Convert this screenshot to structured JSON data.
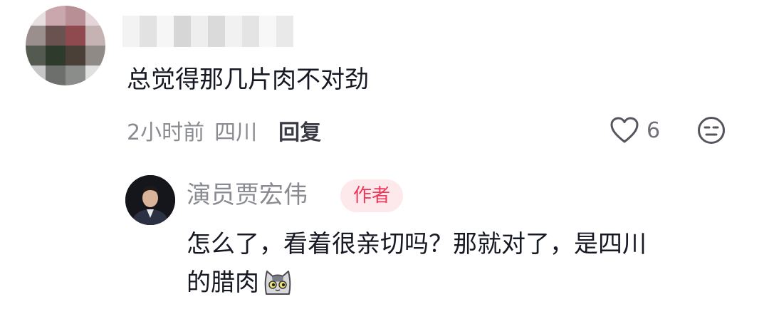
{
  "comment": {
    "text": "总觉得那几片肉不对劲",
    "time": "2小时前",
    "location": "四川",
    "reply_label": "回复",
    "like_count": "6",
    "icons": {
      "like": "heart-icon",
      "dislike": "unhappy-face-icon"
    }
  },
  "reply": {
    "author_name": "演员贾宏伟",
    "author_badge": "作者",
    "text_line1": "怎么了，看着很亲切吗？那就对了，是四川",
    "text_line2": "的腊肉",
    "emoji": "cat-emoji"
  },
  "colors": {
    "text_primary": "#161823",
    "text_secondary": "#8a8b91",
    "badge_bg": "#fde8ec",
    "badge_text": "#f0385a"
  }
}
